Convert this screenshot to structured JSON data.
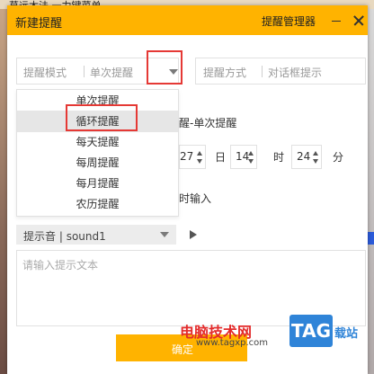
{
  "background": {
    "top_text": "草远木法  一力键菜单"
  },
  "dialog": {
    "title": "新建提醒",
    "manager_label": "提醒管理器"
  },
  "mode_select": {
    "label": "提醒模式",
    "value": "单次提醒"
  },
  "method_select": {
    "label": "提醒方式",
    "value": "对话框提示"
  },
  "mode_options": [
    "单次提醒",
    "循环提醒",
    "每天提醒",
    "每周提醒",
    "每月提醒",
    "农历提醒"
  ],
  "selected_option_index": 1,
  "description": "醒-单次提醒",
  "time": {
    "minute_field": "27",
    "day_unit": "日",
    "hour": "14",
    "hour_unit": "时",
    "minute": "24",
    "minute_unit": "分"
  },
  "input_hint": "时输入",
  "sound": {
    "label": "提示音",
    "value": "sound1"
  },
  "text_placeholder": "请输入提示文本",
  "confirm_label": "确定",
  "watermark": {
    "site_name": "电脑技术网",
    "url": "www.tagxp.com",
    "tag": "TAG",
    "tail": "载站"
  },
  "colors": {
    "accent": "#ffb300",
    "highlight": "#e53935",
    "watermark_blue": "#2f84d8"
  },
  "icons": [
    "minimize-icon",
    "close-icon",
    "chevron-down-icon",
    "play-icon"
  ]
}
